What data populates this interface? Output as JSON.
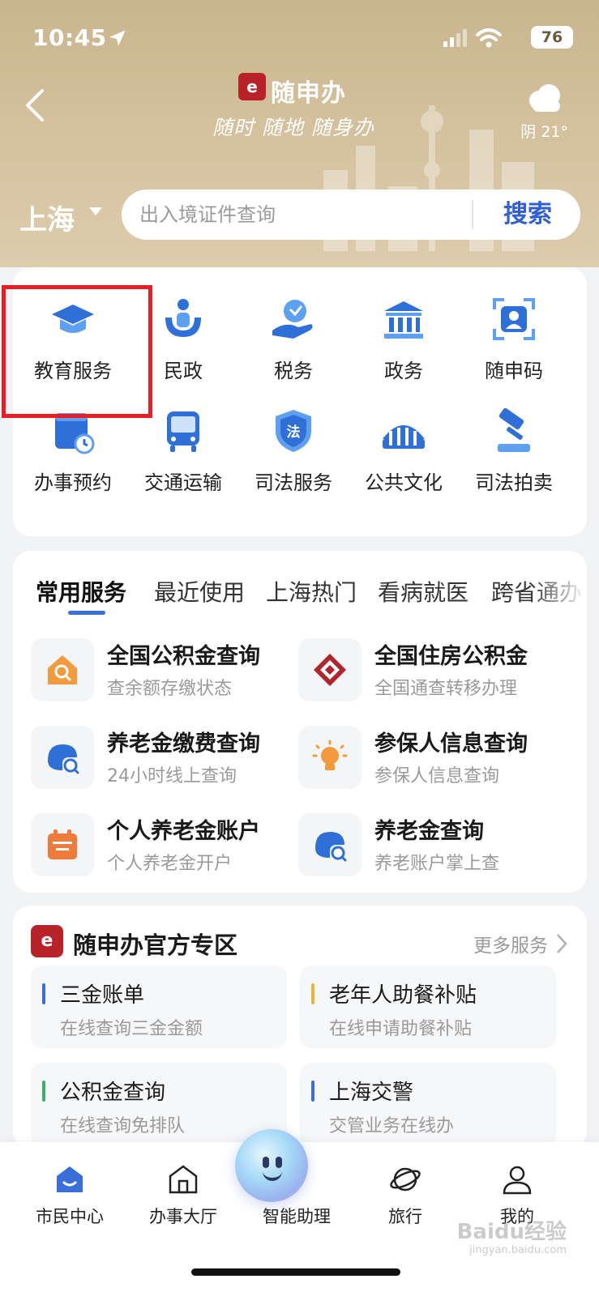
{
  "status_bar": {
    "time": "10:45",
    "battery": "76"
  },
  "header": {
    "app_name": "随申办",
    "slogan": "随时 随地 随身办",
    "weather": "阴 21°",
    "city": "上海",
    "search_placeholder": "出入境证件查询",
    "search_button": "搜索"
  },
  "grid": {
    "items": [
      {
        "label": "教育服务",
        "icon": "graduation-cap-icon"
      },
      {
        "label": "民政",
        "icon": "civil-affairs-icon"
      },
      {
        "label": "税务",
        "icon": "tax-icon"
      },
      {
        "label": "政务",
        "icon": "government-building-icon"
      },
      {
        "label": "随申码",
        "icon": "id-code-icon"
      },
      {
        "label": "办事预约",
        "icon": "appointment-calendar-icon"
      },
      {
        "label": "交通运输",
        "icon": "bus-icon"
      },
      {
        "label": "司法服务",
        "icon": "law-shield-icon"
      },
      {
        "label": "公共文化",
        "icon": "stadium-icon"
      },
      {
        "label": "司法拍卖",
        "icon": "gavel-icon"
      }
    ],
    "law_badge": "法"
  },
  "services": {
    "tabs": [
      "常用服务",
      "最近使用",
      "上海热门",
      "看病就医",
      "跨省通办"
    ],
    "items": [
      {
        "title": "全国公积金查询",
        "subtitle": "查余额存缴状态",
        "icon": "house-search-icon"
      },
      {
        "title": "全国住房公积金",
        "subtitle": "全国通查转移办理",
        "icon": "housing-fund-logo-icon"
      },
      {
        "title": "养老金缴费查询",
        "subtitle": "24小时线上查询",
        "icon": "pension-search-icon"
      },
      {
        "title": "参保人信息查询",
        "subtitle": "参保人信息查询",
        "icon": "lightbulb-icon"
      },
      {
        "title": "个人养老金账户",
        "subtitle": "个人养老金开户",
        "icon": "calendar-icon"
      },
      {
        "title": "养老金查询",
        "subtitle": "养老账户掌上查",
        "icon": "pension-search-icon"
      }
    ]
  },
  "zone": {
    "title": "随申办官方专区",
    "more": "更多服务",
    "items": [
      {
        "title": "三金账单",
        "subtitle": "在线查询三金金额",
        "bar_color": "#3a6fd8"
      },
      {
        "title": "老年人助餐补贴",
        "subtitle": "在线申请助餐补贴",
        "bar_color": "#e9b43c"
      },
      {
        "title": "公积金查询",
        "subtitle": "在线查询免排队",
        "bar_color": "#3fae6b"
      },
      {
        "title": "上海交警",
        "subtitle": "交管业务在线办",
        "bar_color": "#3a6fd8"
      }
    ]
  },
  "tabbar": {
    "items": [
      {
        "label": "市民中心",
        "icon": "citizen-center-icon"
      },
      {
        "label": "办事大厅",
        "icon": "service-hall-icon"
      },
      {
        "label": "智能助理",
        "icon": "assistant-orb-icon"
      },
      {
        "label": "旅行",
        "icon": "travel-planet-icon"
      },
      {
        "label": "我的",
        "icon": "profile-icon"
      }
    ]
  },
  "watermark": {
    "brand": "Baidu经验",
    "url": "jingyan.baidu.com"
  },
  "colors": {
    "accent": "#3a6fd8",
    "brand_red": "#b8232a",
    "highlight": "#ea1c24",
    "header_gold": "#c9b58f"
  }
}
